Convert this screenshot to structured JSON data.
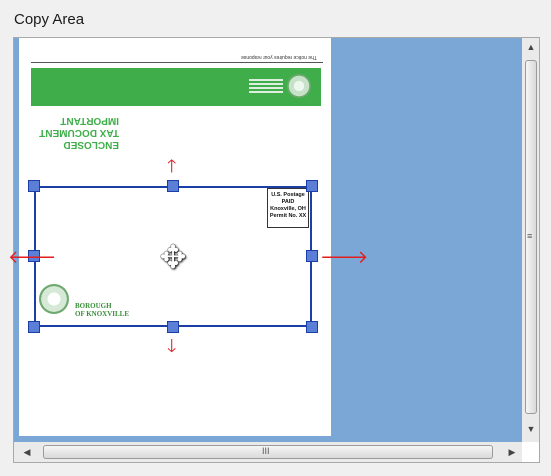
{
  "panel": {
    "title": "Copy Area"
  },
  "document": {
    "top_tiny_text": "The notice requires your response",
    "notice_lines": [
      "ENCLOSED",
      "TAX DOCUMENT",
      "IMPORTANT"
    ],
    "postage_lines": [
      "U.S. Postage",
      "PAID",
      "Knoxville, OH",
      "Permit No. XX"
    ],
    "borough_lines": [
      "BOROUGH",
      "OF KNOXVILLE"
    ]
  },
  "cursor": {
    "icon": "move-cursor-icon"
  },
  "scrollbars": {
    "vertical": {
      "up": "▲",
      "down": "▼",
      "grip": "≡"
    },
    "horizontal": {
      "left": "◀",
      "right": "▶",
      "grip": "III"
    }
  },
  "colors": {
    "canvas_bg": "#7ba7d6",
    "selection": "#1b3fa6",
    "handle": "#5b7fd6",
    "arrows": "#e21e1e",
    "band": "#3fae4a"
  }
}
